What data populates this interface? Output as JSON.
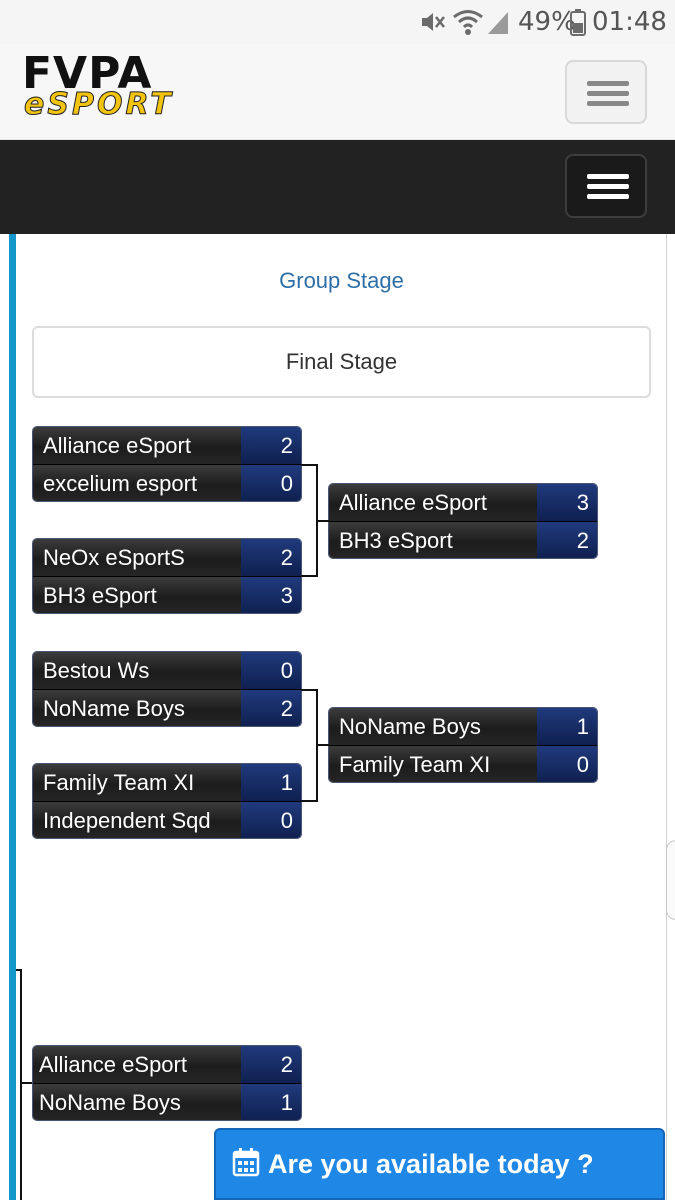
{
  "status_bar": {
    "battery_percent": "49%",
    "time": "01:48",
    "icons": [
      "mute-icon",
      "wifi-icon",
      "signal-icon",
      "battery-icon"
    ]
  },
  "header": {
    "logo_top": "FVPA",
    "logo_bottom": "eSPORT",
    "brand_yellow": "#f2c40f"
  },
  "tabs": {
    "group_stage": "Group Stage",
    "final_stage": "Final Stage"
  },
  "bracket": {
    "round1": [
      {
        "team1": "Alliance eSport",
        "score1": "2",
        "team2": "excelium esport",
        "score2": "0"
      },
      {
        "team1": "NeOx eSportS",
        "score1": "2",
        "team2": "BH3 eSport",
        "score2": "3"
      },
      {
        "team1": "Bestou Ws",
        "score1": "0",
        "team2": "NoName Boys",
        "score2": "2"
      },
      {
        "team1": "Family Team XI",
        "score1": "1",
        "team2": "Independent Sqd",
        "score2": "0"
      }
    ],
    "round2": [
      {
        "team1": "Alliance eSport",
        "score1": "3",
        "team2": "BH3 eSport",
        "score2": "2"
      },
      {
        "team1": "NoName Boys",
        "score1": "1",
        "team2": "Family Team XI",
        "score2": "0"
      }
    ],
    "final": {
      "team1": "Alliance eSport",
      "score1": "2",
      "team2": "NoName Boys",
      "score2": "1"
    }
  },
  "availability_button": {
    "label": "Are you available today ?",
    "icon": "calendar-icon",
    "color": "#1f87e6"
  },
  "colors": {
    "accent": "#1597c9",
    "link": "#2e6fa7",
    "score_bg": "#0f2050"
  }
}
